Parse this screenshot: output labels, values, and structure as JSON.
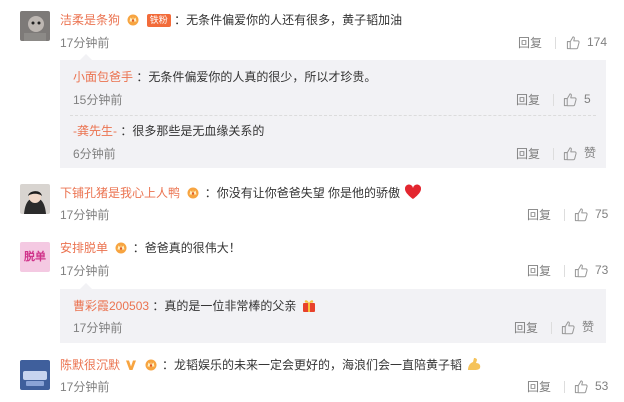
{
  "comments": [
    {
      "user": "洁柔是条狗",
      "badge": "铁粉",
      "text": "：无条件偏爱你的人还有很多，黄子韬加油",
      "time": "17分钟前",
      "reply": "回复",
      "likes": "174"
    },
    {
      "user": "下铺孔猪是我心上人鸭",
      "text": "：你没有让你爸爸失望 你是他的骄傲",
      "time": "17分钟前",
      "reply": "回复",
      "likes": "75"
    },
    {
      "user": "安排脱单",
      "text": "：爸爸真的很伟大！",
      "time": "17分钟前",
      "reply": "回复",
      "likes": "73"
    },
    {
      "user": "陈默很沉默",
      "text": "：龙韬娱乐的未来一定会更好的，海浪们会一直陪黄子韬",
      "time": "17分钟前",
      "reply": "回复",
      "likes": "53"
    }
  ],
  "replies_1": [
    {
      "user": "小面包爸手",
      "text": "：无条件偏爱你的人真的很少，所以才珍贵。",
      "time": "15分钟前",
      "reply": "回复",
      "likes": "5"
    },
    {
      "user": "-龚先生-",
      "text": "：很多那些是无血缘关系的",
      "time": "6分钟前",
      "reply": "回复",
      "likes": "赞"
    }
  ],
  "replies_3": [
    {
      "user": "曹彩霞200503",
      "text": "：真的是一位非常棒的父亲",
      "time": "17分钟前",
      "reply": "回复",
      "likes": "赞"
    }
  ],
  "avatar_3_text": "脱单",
  "colors": {
    "username": "#eb7350",
    "meta": "#808080",
    "reply_bg": "#f2f2f5"
  },
  "icons": [
    "thumb-up-icon",
    "crown-badge-icon",
    "heart-emoji",
    "strong-arm-emoji",
    "gift-emoji",
    "verified-v-icon"
  ]
}
